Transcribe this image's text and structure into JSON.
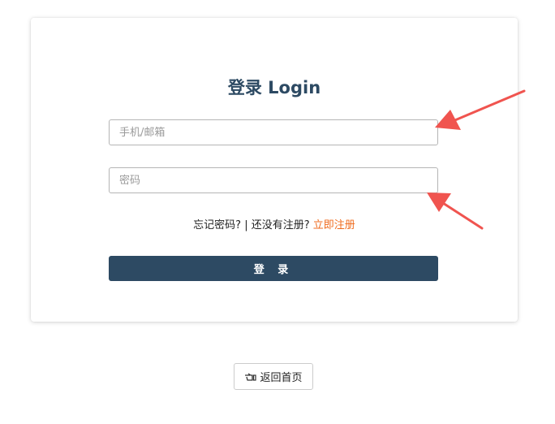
{
  "login": {
    "title": "登录 Login",
    "account_placeholder": "手机/邮箱",
    "password_placeholder": "密码",
    "forgot_password": "忘记密码?",
    "separator": "|",
    "no_account": "还没有注册?",
    "register_now": "立即注册",
    "submit_label": "登 录"
  },
  "footer": {
    "home_label": "返回首页",
    "home_icon": "hand-pointing-icon"
  },
  "colors": {
    "accent": "#2d4a63",
    "link_highlight": "#ef6a1c",
    "annotation_arrow": "#f0544f"
  }
}
